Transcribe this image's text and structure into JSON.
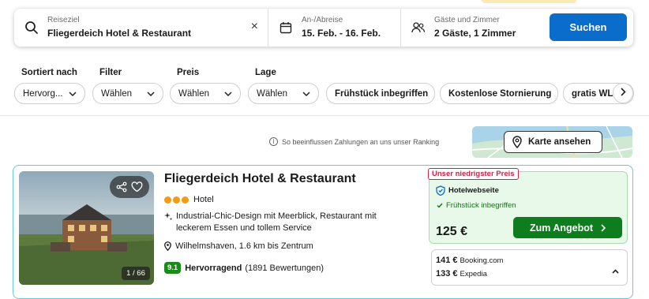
{
  "search": {
    "destination_label": "Reiseziel",
    "destination_value": "Fliegerdeich Hotel & Restaurant",
    "dates_label": "An-/Abreise",
    "dates_value": "15. Feb. - 16. Feb.",
    "guests_label": "Gäste und Zimmer",
    "guests_value": "2 Gäste, 1 Zimmer",
    "search_button": "Suchen",
    "clear_symbol": "×"
  },
  "filters": {
    "sort": {
      "label": "Sortiert nach",
      "value": "Hervorg..."
    },
    "filter": {
      "label": "Filter",
      "value": "Wählen"
    },
    "price": {
      "label": "Preis",
      "value": "Wählen"
    },
    "location": {
      "label": "Lage",
      "value": "Wählen"
    },
    "chips": [
      "Frühstück inbegriffen",
      "Kostenlose Stornierung",
      "gratis WLAN"
    ]
  },
  "ranking_info": "So beeinflussen Zahlungen an uns unser Ranking",
  "map_button": "Karte ansehen",
  "hotel": {
    "name": "Fliegerdeich Hotel & Restaurant",
    "type": "Hotel",
    "stars": 3,
    "feature": "Industrial-Chic-Design mit Meerblick, Restaurant mit leckerem Essen und tollem Service",
    "location": "Wilhelmshaven, 1.6 km bis Zentrum",
    "rating_score": "9.1",
    "rating_word": "Hervorragend",
    "rating_count": "(1891 Bewertungen)",
    "photo_count": "1 / 66"
  },
  "offer": {
    "badge": "Unser niedrigster Preis",
    "provider": "Hotelwebseite",
    "breakfast": "Frühstück inbegriffen",
    "price": "125 €",
    "button": "Zum Angebot"
  },
  "other_offers": [
    {
      "price": "141 €",
      "provider": "Booking.com"
    },
    {
      "price": "133 €",
      "provider": "Expedia"
    }
  ],
  "colors": {
    "primary": "#0a6ccb",
    "deal_green": "#0e7d1e",
    "rating_green": "#1a8a1a",
    "badge_red": "#c7254e",
    "star_orange": "#f39c12"
  }
}
